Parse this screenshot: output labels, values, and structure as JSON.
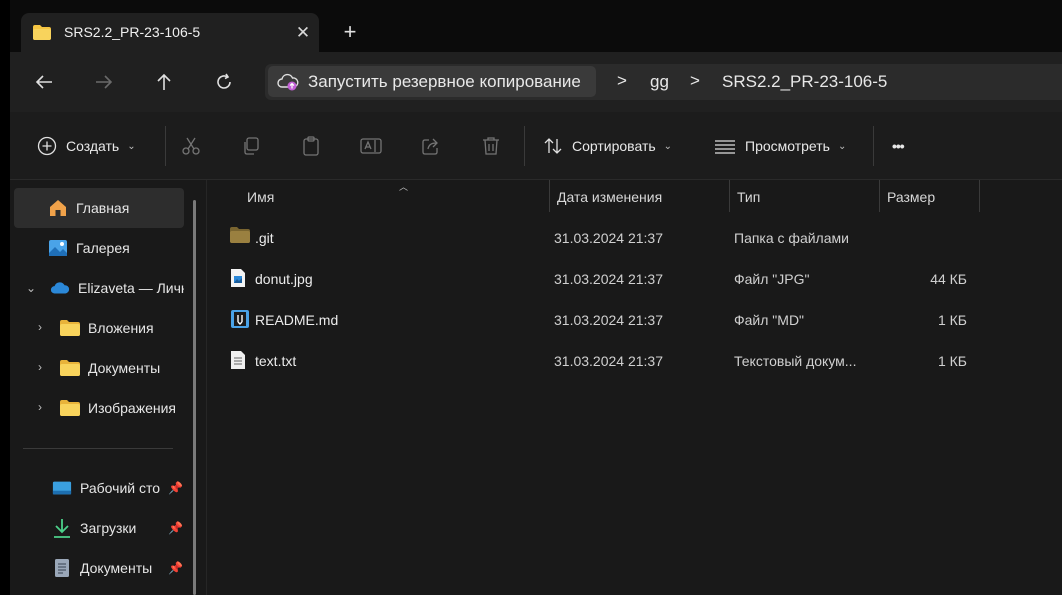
{
  "tab": {
    "title": "SRS2.2_PR-23-106-5",
    "close": "✕",
    "new_tab": "+"
  },
  "navbar": {
    "breadcrumbs": [
      "Запустить резервное копирование",
      "gg",
      "SRS2.2_PR-23-106-5"
    ],
    "separator": ">"
  },
  "toolbar": {
    "create_label": "Создать",
    "sort_label": "Сортировать",
    "view_label": "Просмотреть",
    "more_label": "•••"
  },
  "sidebar": {
    "items": [
      {
        "label": "Главная",
        "icon": "home-icon"
      },
      {
        "label": "Галерея",
        "icon": "gallery-icon"
      },
      {
        "label": "Elizaveta — Личн",
        "icon": "onedrive-cloud-icon"
      },
      {
        "label": "Вложения",
        "icon": "folder-icon"
      },
      {
        "label": "Документы",
        "icon": "folder-icon"
      },
      {
        "label": "Изображения",
        "icon": "folder-icon"
      },
      {
        "label": "Рабочий сто",
        "icon": "desktop-icon"
      },
      {
        "label": "Загрузки",
        "icon": "download-icon"
      },
      {
        "label": "Документы",
        "icon": "documents-icon"
      }
    ]
  },
  "columns": {
    "name": "Имя",
    "modified": "Дата изменения",
    "type": "Тип",
    "size": "Размер"
  },
  "files": [
    {
      "name": ".git",
      "date": "31.03.2024 21:37",
      "type": "Папка с файлами",
      "size": "",
      "icon": "folder-icon"
    },
    {
      "name": "donut.jpg",
      "date": "31.03.2024 21:37",
      "type": "Файл \"JPG\"",
      "size": "44 КБ",
      "icon": "image-file-icon"
    },
    {
      "name": "README.md",
      "date": "31.03.2024 21:37",
      "type": "Файл \"MD\"",
      "size": "1 КБ",
      "icon": "markdown-file-icon"
    },
    {
      "name": "text.txt",
      "date": "31.03.2024 21:37",
      "type": "Текстовый докум...",
      "size": "1 КБ",
      "icon": "text-file-icon"
    }
  ],
  "colors": {
    "accent": "#4cc2ff",
    "folder": "#f5c542",
    "window_bg": "#191919"
  }
}
